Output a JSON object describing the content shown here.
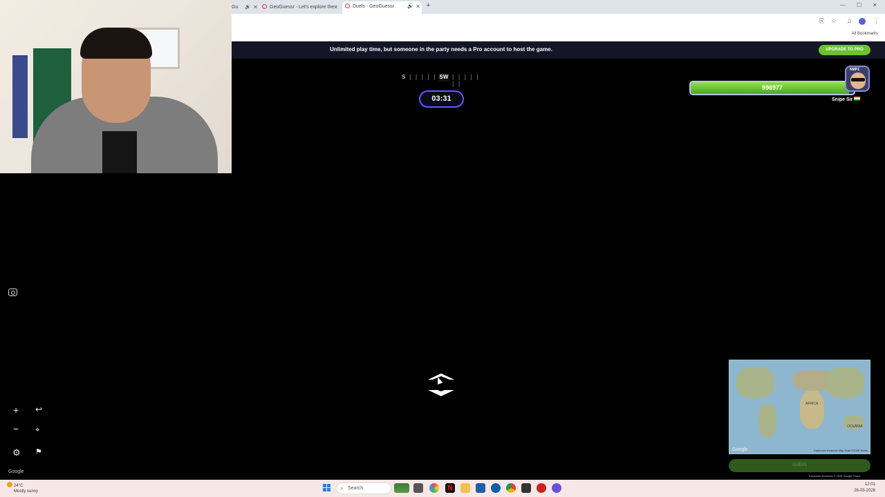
{
  "browser": {
    "tabs": [
      {
        "label": "Gu"
      },
      {
        "label": "GeoGuessr - Let's explore the"
      },
      {
        "label": "Duels - GeoGuessr",
        "active": true
      }
    ],
    "bookmarks_label": "All Bookmarks"
  },
  "banner": {
    "text": "Unlimited play time, but someone in the party needs a Pro account to host the game.",
    "upgrade_label": "UPGRADE TO PRO"
  },
  "compass": {
    "left_label": "S",
    "ticks": "| | | | | | |",
    "center_label": "SW",
    "right_ticks": "| | | | | | |"
  },
  "timer": "03:31",
  "player": {
    "health": "996977",
    "health_fraction": 0.97,
    "name": "Snipe Sir",
    "avatar_tag": "NMPZ",
    "flag": "india-flag"
  },
  "controls": {
    "zoom_in": "+",
    "zoom_out": "−",
    "undo": "↩",
    "checkpoint": "checkpoint-icon",
    "settings": "gear-icon",
    "flag": "flag-icon"
  },
  "google_label": "Google",
  "minimap": {
    "labels": {
      "africa": "AFRICA",
      "oceania": "OCEANIA"
    },
    "google": "Google",
    "footer": "Keyboard shortcuts  Map Data ©2026  Terms"
  },
  "guess_label": "GUESS",
  "kb_footer": "Keyboard shortcuts   © 2026 Google   Terms",
  "taskbar": {
    "weather_temp": "24°C",
    "weather_desc": "Mostly sunny",
    "search_label": "Search",
    "time": "12:01",
    "date": "26-03-2026"
  },
  "colors": {
    "accent": "#6a56ff",
    "health_green": "#6cc22f",
    "banner_bg": "#141628"
  }
}
